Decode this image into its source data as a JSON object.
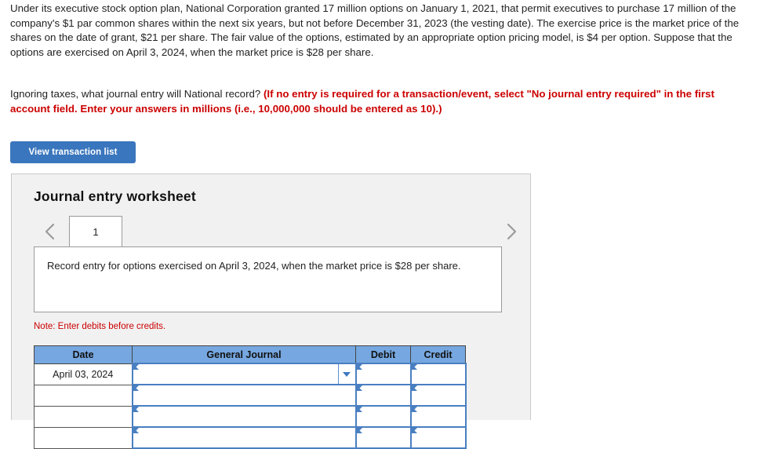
{
  "question": {
    "paragraph1": "Under its executive stock option plan, National Corporation granted 17 million options on January 1, 2021, that permit executives to purchase 17 million of the company's $1 par common shares within the next six years, but not before December 31, 2023 (the vesting date). The exercise price is the market price of the shares on the date of grant, $21 per share. The fair value of the options, estimated by an appropriate option pricing model, is $4 per option. Suppose that the options are exercised on April 3, 2024, when the market price is $28 per share.",
    "paragraph2_plain": "Ignoring taxes, what journal entry will National record? ",
    "paragraph2_bold_red": "(If no entry is required for a transaction/event, select \"No journal entry required\" in the first account field. Enter your answers in millions (i.e., 10,000,000 should be entered as 10).)"
  },
  "toolbar": {
    "view_transaction_list_label": "View transaction list",
    "button_color": "#3a76bd"
  },
  "worksheet": {
    "title": "Journal entry worksheet",
    "prev_icon": "chevron-left-icon",
    "next_icon": "chevron-right-icon",
    "tabs": [
      {
        "label": "1",
        "active": true
      }
    ],
    "description": "Record entry for options exercised on April 3, 2024, when the market price is $28 per share.",
    "note": "Note: Enter debits before credits.",
    "note_color": "#cc0000"
  },
  "journal_table": {
    "header_color": "#76a7e0",
    "columns": [
      {
        "key": "date",
        "label": "Date"
      },
      {
        "key": "general_journal",
        "label": "General Journal"
      },
      {
        "key": "debit",
        "label": "Debit"
      },
      {
        "key": "credit",
        "label": "Credit"
      }
    ],
    "rows": [
      {
        "date": "April 03, 2024",
        "general_journal": "",
        "general_journal_placeholder": "",
        "has_dropdown": true,
        "debit": "",
        "credit": ""
      },
      {
        "date": "",
        "general_journal": "",
        "general_journal_placeholder": "",
        "has_dropdown": false,
        "debit": "",
        "credit": ""
      },
      {
        "date": "",
        "general_journal": "",
        "general_journal_placeholder": "",
        "has_dropdown": false,
        "debit": "",
        "credit": ""
      },
      {
        "date": "",
        "general_journal": "",
        "general_journal_placeholder": "",
        "has_dropdown": false,
        "debit": "",
        "credit": ""
      }
    ]
  }
}
